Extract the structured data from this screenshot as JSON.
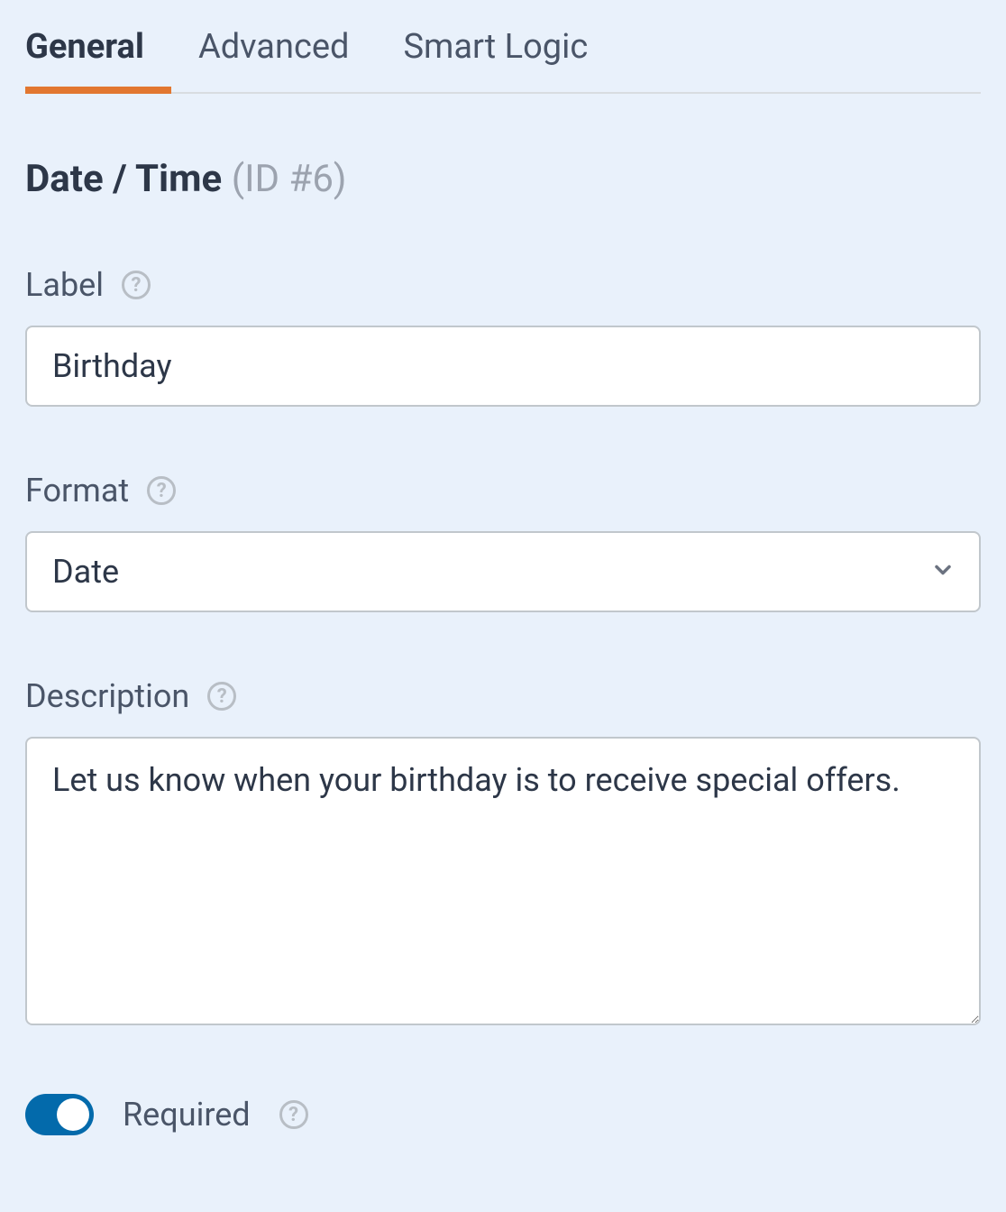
{
  "tabs": {
    "items": [
      {
        "label": "General",
        "active": true
      },
      {
        "label": "Advanced",
        "active": false
      },
      {
        "label": "Smart Logic",
        "active": false
      }
    ]
  },
  "heading": {
    "title": "Date / Time",
    "id_text": "(ID #6)"
  },
  "fields": {
    "label": {
      "caption": "Label",
      "value": "Birthday"
    },
    "format": {
      "caption": "Format",
      "value": "Date"
    },
    "description": {
      "caption": "Description",
      "value": "Let us know when your birthday is to receive special offers."
    },
    "required": {
      "caption": "Required",
      "enabled": true
    }
  }
}
